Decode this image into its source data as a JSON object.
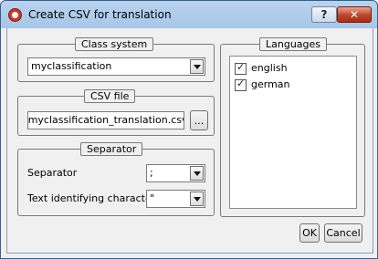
{
  "window": {
    "title": "Create CSV for translation",
    "help_label": "?",
    "close_label": "✕"
  },
  "class_system": {
    "legend": "Class system",
    "value": "myclassification"
  },
  "csv_file": {
    "legend": "CSV file",
    "path": "\\myclassification_translation.csv",
    "browse_label": "..."
  },
  "separator": {
    "legend": "Separator",
    "separator_label": "Separator",
    "separator_value": ";",
    "text_char_label": "Text identifying character",
    "text_char_value": "\""
  },
  "languages": {
    "legend": "Languages",
    "items": [
      {
        "label": "english",
        "checked": true
      },
      {
        "label": "german",
        "checked": true
      }
    ]
  },
  "buttons": {
    "ok": "OK",
    "cancel": "Cancel"
  }
}
